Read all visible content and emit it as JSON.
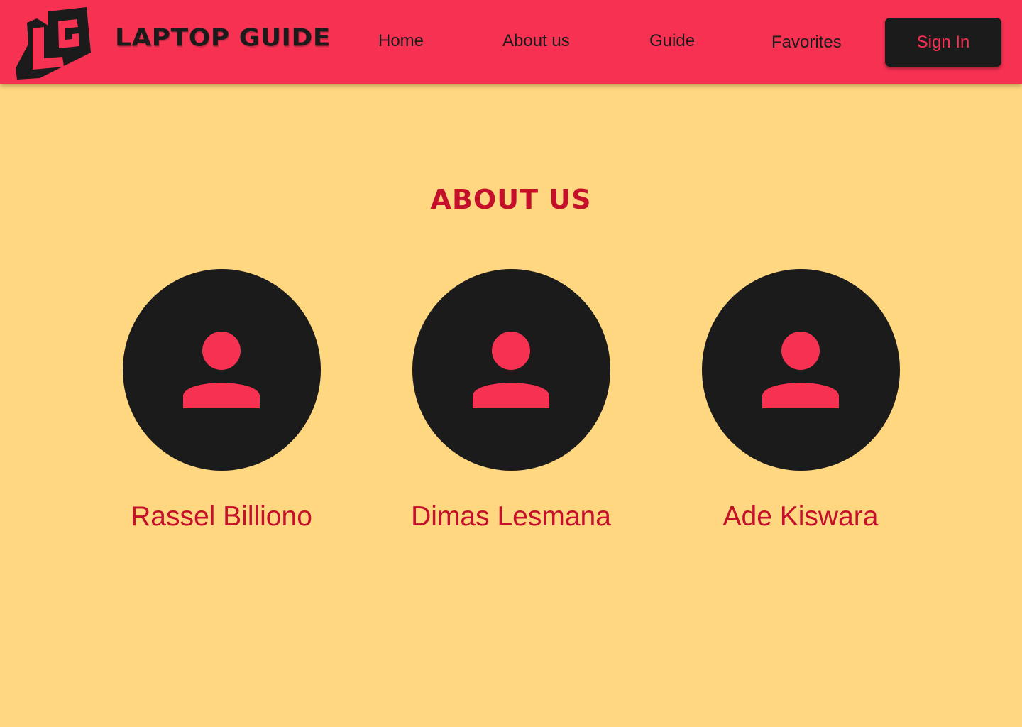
{
  "header": {
    "brand": "LAPTOP GUIDE",
    "logo_letters": "LG",
    "nav": [
      {
        "label": "Home"
      },
      {
        "label": "About us"
      },
      {
        "label": "Guide"
      },
      {
        "label": "Favorites"
      }
    ],
    "signin_label": "Sign In"
  },
  "main": {
    "title": "ABOUT US",
    "members": [
      {
        "name": "Rassel Billiono",
        "icon": "person-icon"
      },
      {
        "name": "Dimas Lesmana",
        "icon": "person-icon"
      },
      {
        "name": "Ade Kiswara",
        "icon": "person-icon"
      }
    ]
  },
  "colors": {
    "background": "#FFD780",
    "navbar": "#F73152",
    "dark": "#1B1B1B",
    "accent_text": "#C4102A"
  }
}
